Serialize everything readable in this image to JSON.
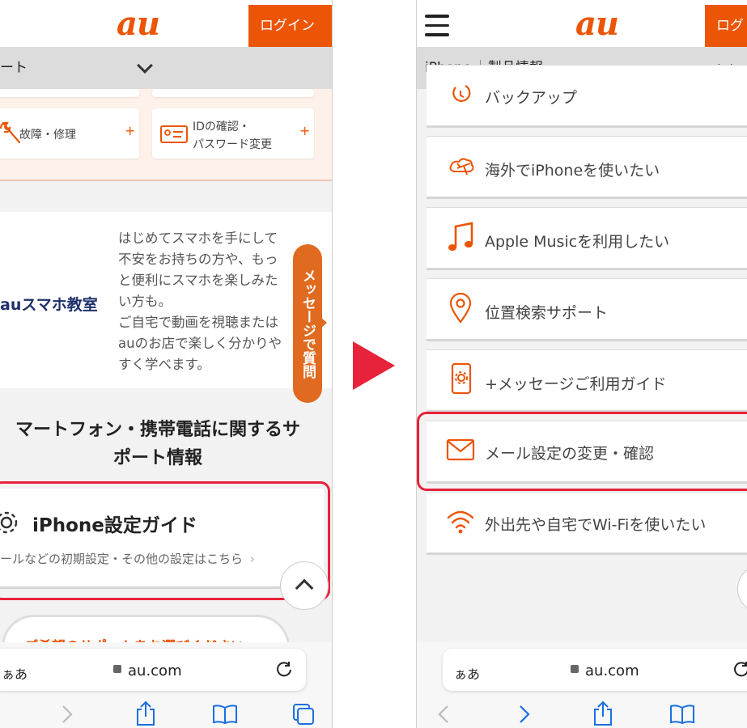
{
  "colors": {
    "accent": "#eb5505",
    "highlight": "#e8223a",
    "lesson": "#1d2f6b"
  },
  "left": {
    "logo": "au",
    "login": "ログイン",
    "breadcrumb": "ート",
    "cards": [
      {
        "label": "故障・修理",
        "icon": "wrench-icon"
      },
      {
        "label_line1": "IDの確認・",
        "label_line2": "パスワード変更",
        "icon": "id-card-icon"
      }
    ],
    "plus": "+",
    "lesson_title": "スマホ教室",
    "lesson_prefix": "au",
    "lesson_text_lines": [
      "はじめてスマホを手にして",
      "不安をお持ちの方や、もっ",
      "と便利にスマホを楽しみた",
      "い方も。",
      "ご自宅で動画を視聴または",
      "auのお店で楽しく分かりや",
      "すく学べます。"
    ],
    "floating_tab": "メッセージで質問",
    "section_title_line1": "マートフォン・携帯電話に関するサ",
    "section_title_line2": "ポート情報",
    "guide_title": "iPhone設定ガイド",
    "guide_sub": "ールなどの初期設定・その他の設定はこちら",
    "pill_text": "ご希望のサポートをお選びください",
    "aa": "ぁあ",
    "url": "au.com"
  },
  "right": {
    "logo": "au",
    "login": "ログ",
    "breadcrumb_1": "iPhone",
    "breadcrumb_2": "製品情報",
    "items": [
      {
        "label": "バックアップ",
        "icon": "backup-icon"
      },
      {
        "label": "海外でiPhoneを使いたい",
        "icon": "airplane-icon"
      },
      {
        "label": "Apple Musicを利用したい",
        "icon": "music-note-icon"
      },
      {
        "label": "位置検索サポート",
        "icon": "location-pin-icon"
      },
      {
        "label": "+メッセージご利用ガイド",
        "icon": "phone-settings-icon"
      },
      {
        "label": "メール設定の変更・確認",
        "icon": "mail-icon"
      },
      {
        "label": "外出先や自宅でWi-Fiを使いたい",
        "icon": "wifi-icon"
      }
    ],
    "aa": "ぁあ",
    "url": "au.com"
  }
}
